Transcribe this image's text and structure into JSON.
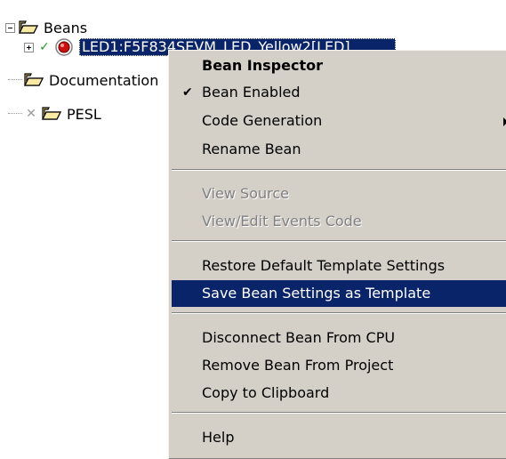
{
  "tree": {
    "beans": {
      "label": "Beans",
      "icon": "folder-open-icon",
      "expander": "minus"
    },
    "led_bean": {
      "label": "LED1:F5F834SEVM_LED_Yellow2[LED]",
      "status_icon": "check-icon",
      "bean_icon": "led-bean-icon",
      "expander": "plus"
    },
    "documentation": {
      "label": "Documentation",
      "icon": "folder-open-icon"
    },
    "pesl": {
      "label": "PESL",
      "status_icon": "x-icon",
      "icon": "folder-open-icon"
    }
  },
  "context_menu": {
    "items": [
      {
        "label": "Bean Inspector",
        "bold": true
      },
      {
        "label": "Bean Enabled",
        "checked": true
      },
      {
        "label": "Code Generation",
        "submenu": true
      },
      {
        "label": "Rename Bean"
      },
      {
        "label": "View Source",
        "disabled": true
      },
      {
        "label": "View/Edit Events Code",
        "disabled": true
      },
      {
        "label": "Restore Default Template Settings"
      },
      {
        "label": "Save Bean Settings as Template",
        "highlighted": true
      },
      {
        "label": "Disconnect Bean From CPU"
      },
      {
        "label": "Remove Bean From Project"
      },
      {
        "label": "Copy to Clipboard"
      },
      {
        "label": "Help"
      }
    ]
  },
  "colors": {
    "selection": "#0a246a",
    "menu_bg": "#d4d0c8",
    "disabled_text": "#808080",
    "folder": "#f5d76e",
    "check": "#2a9a2a"
  }
}
